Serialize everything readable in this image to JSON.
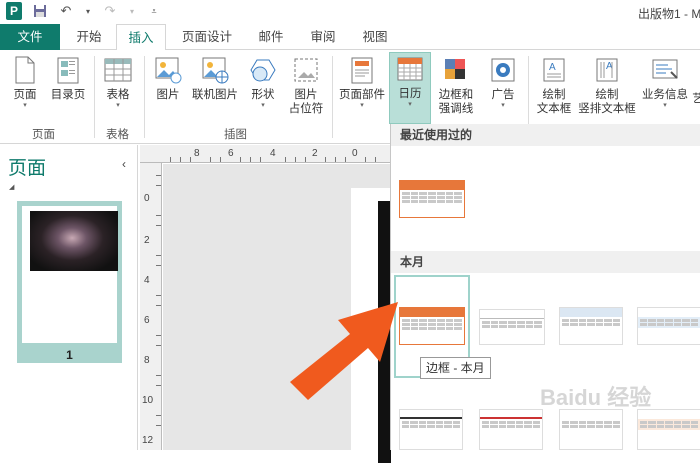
{
  "titlebar": {
    "title": "出版物1 - M",
    "undo_icon": "undo-icon",
    "redo_icon": "redo-icon"
  },
  "tabs": [
    "文件",
    "开始",
    "插入",
    "页面设计",
    "邮件",
    "审阅",
    "视图"
  ],
  "active_tab": "插入",
  "ribbon": {
    "pages_group": {
      "label": "页面",
      "page": "页面",
      "catalog": "目录页"
    },
    "tables_group": {
      "label": "表格",
      "table": "表格"
    },
    "illustrations_group": {
      "label": "插图",
      "picture": "图片",
      "online_picture": "联机图片",
      "shapes": "形状",
      "placeholder_line1": "图片",
      "placeholder_line2": "占位符"
    },
    "page_parts": "页面部件",
    "calendar": "日历",
    "borders_line1": "边框和",
    "borders_line2": "强调线",
    "ads": "广告",
    "draw_text_line1": "绘制",
    "draw_text_line2": "文本框",
    "draw_vertical_line1": "绘制",
    "draw_vertical_line2": "竖排文本框",
    "business_info": "业务信息",
    "cut_off": "艺"
  },
  "pages_pane": {
    "title": "页面",
    "collapse_glyph": "‹",
    "page_number": "1"
  },
  "ruler_h": [
    "8",
    "6",
    "4",
    "2",
    "0"
  ],
  "ruler_v": [
    "0",
    "2",
    "4",
    "6",
    "8",
    "10",
    "12"
  ],
  "gallery": {
    "recent_label": "最近使用过的",
    "this_month_label": "本月",
    "tooltip": "边框 - 本月"
  },
  "colors": {
    "accent": "#0f7b6c",
    "calendar_orange": "#e7773a",
    "arrow": "#f05a1e"
  },
  "watermark": "Baidu 经验"
}
